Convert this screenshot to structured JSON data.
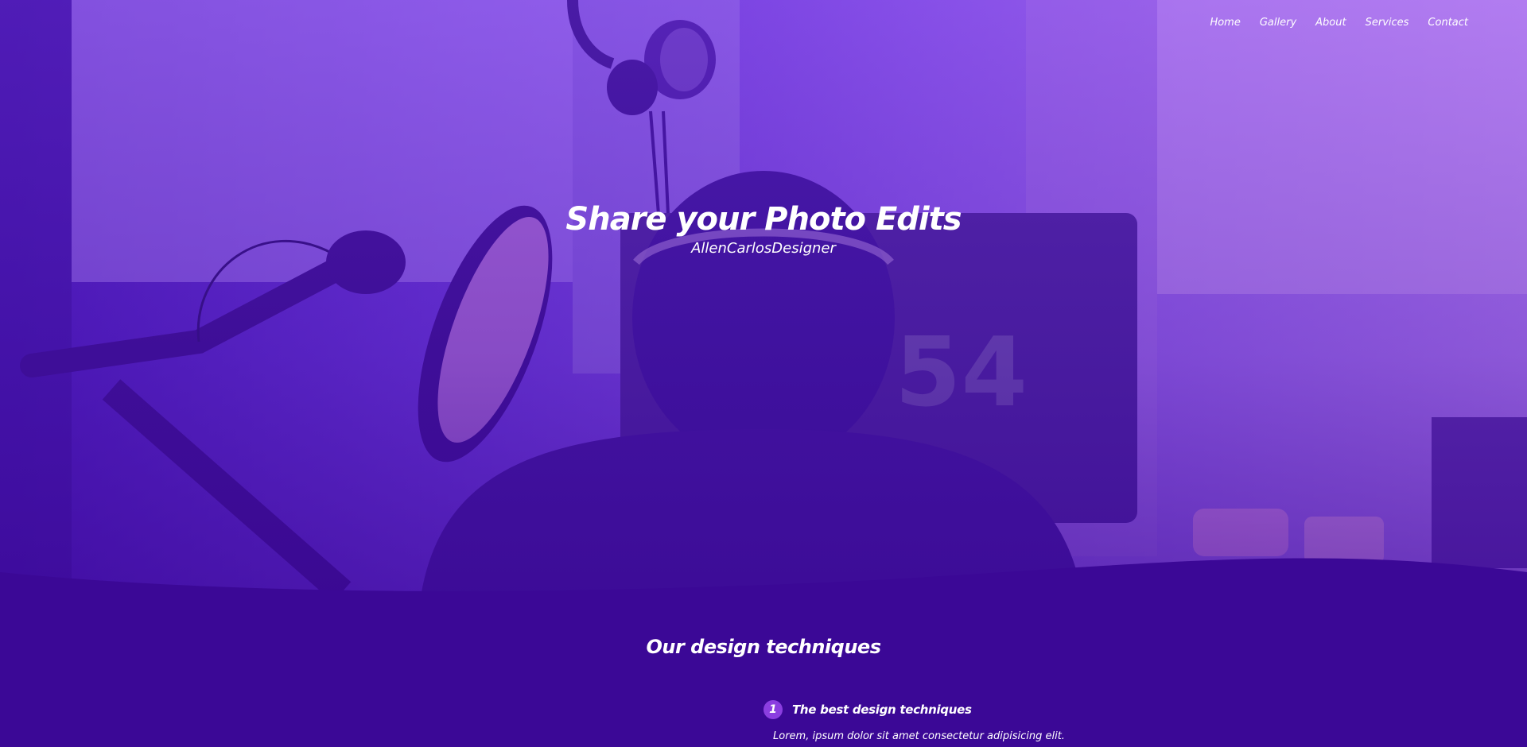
{
  "nav": {
    "items": [
      {
        "label": "Home"
      },
      {
        "label": "Gallery"
      },
      {
        "label": "About"
      },
      {
        "label": "Services"
      },
      {
        "label": "Contact"
      }
    ]
  },
  "hero": {
    "title": "Share your Photo Edits",
    "subtitle": "AllenCarlosDesigner",
    "monitor_number": "54"
  },
  "section": {
    "title": "Our design techniques",
    "techniques": [
      {
        "number": "1",
        "title": "The best design techniques",
        "description": "Lorem, ipsum dolor sit amet consectetur adipisicing elit."
      }
    ]
  },
  "colors": {
    "background": "#3b0896",
    "accent": "#8b3ee0",
    "text": "#ffffff"
  }
}
